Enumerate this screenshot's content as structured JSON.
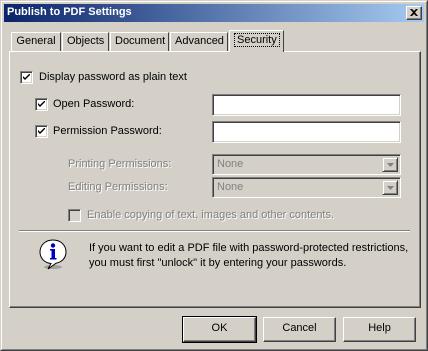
{
  "window": {
    "title": "Publish to PDF Settings",
    "close_label": "close"
  },
  "tabs": [
    {
      "label": "General"
    },
    {
      "label": "Objects"
    },
    {
      "label": "Document"
    },
    {
      "label": "Advanced"
    },
    {
      "label": "Security",
      "active": true
    }
  ],
  "security": {
    "display_plain": {
      "label": "Display password as plain text",
      "checked": true
    },
    "open_password": {
      "label": "Open Password:",
      "checked": true,
      "value": ""
    },
    "permission_password": {
      "label": "Permission Password:",
      "checked": true,
      "value": ""
    },
    "printing_permissions": {
      "label": "Printing Permissions:",
      "value": "None",
      "enabled": false
    },
    "editing_permissions": {
      "label": "Editing Permissions:",
      "value": "None",
      "enabled": false
    },
    "enable_copying": {
      "label": "Enable copying of text, images and other contents.",
      "checked": false,
      "enabled": false
    }
  },
  "info": {
    "icon": "info-icon",
    "line1": "If you want to edit a PDF file with password-protected restrictions,",
    "line2": "you must first \"unlock\" it by entering your passwords."
  },
  "buttons": {
    "ok": "OK",
    "cancel": "Cancel",
    "help": "Help"
  },
  "colors": {
    "title_start": "#0a246a",
    "title_end": "#a6caf0",
    "face": "#d4d0c8"
  }
}
